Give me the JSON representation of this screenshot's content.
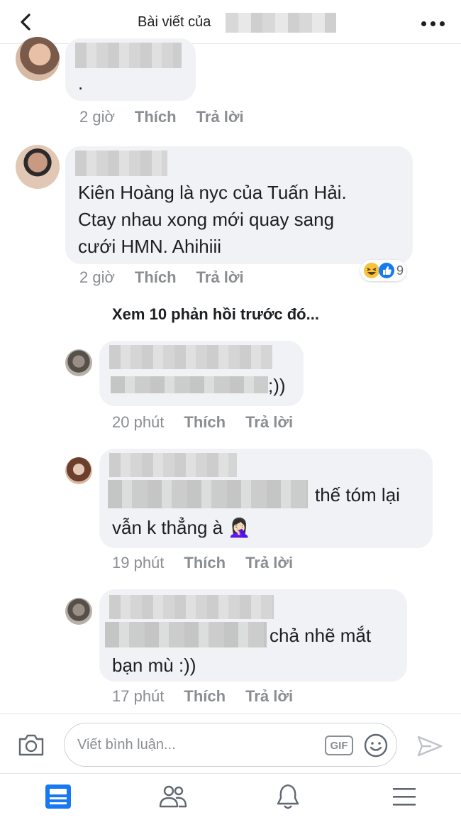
{
  "header": {
    "title": "Bài viết của"
  },
  "comments": [
    {
      "text_lines": [
        "."
      ],
      "time": "2 giờ",
      "like_label": "Thích",
      "reply_label": "Trả lời"
    },
    {
      "text_lines": [
        "Kiên Hoàng là nyc của Tuấn Hải.",
        "Ctay nhau xong mới quay sang",
        "cưới HMN. Ahihiii"
      ],
      "time": "2 giờ",
      "like_label": "Thích",
      "reply_label": "Trả lời",
      "reaction_count": "9"
    }
  ],
  "view_previous_replies": "Xem 10 phản hồi trước đó...",
  "replies": [
    {
      "text_lines": [
        ";))"
      ],
      "time": "20 phút",
      "like_label": "Thích",
      "reply_label": "Trả lời"
    },
    {
      "text_lines": [
        "thế tóm lại",
        "vẫn k thẳng à 🤦🏻‍♀️"
      ],
      "time": "19 phút",
      "like_label": "Thích",
      "reply_label": "Trả lời"
    },
    {
      "text_lines": [
        "chả nhẽ mắt",
        "bạn mù :))"
      ],
      "time": "17 phút",
      "like_label": "Thích",
      "reply_label": "Trả lời"
    }
  ],
  "composer": {
    "placeholder": "Viết bình luận...",
    "gif_label": "GIF"
  },
  "tabbar": {
    "tabs": [
      "news-feed",
      "friends",
      "notifications",
      "menu"
    ],
    "active_color": "#1877f2"
  }
}
